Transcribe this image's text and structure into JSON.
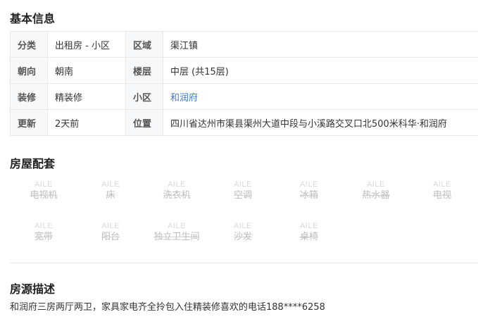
{
  "basic": {
    "title": "基本信息",
    "rows": [
      {
        "l1": "分类",
        "v1": "出租房 - 小区",
        "l2": "区域",
        "v2": "渠江镇"
      },
      {
        "l1": "朝向",
        "v1": "朝南",
        "l2": "楼层",
        "v2": "中层 (共15层)"
      },
      {
        "l1": "装修",
        "v1": "精装修",
        "l2": "小区",
        "v2": "和润府"
      },
      {
        "l1": "更新",
        "v1": "2天前",
        "l2": "位置",
        "v2": "四川省达州市渠县渠州大道中段与小溪路交叉口北500米科华·和润府"
      }
    ],
    "link_color": "#3a79d8"
  },
  "amenities": {
    "title": "房屋配套",
    "icon_text": "AILE",
    "items": [
      {
        "label": "电视机",
        "icon": "tv-icon"
      },
      {
        "label": "床",
        "icon": "bed-icon"
      },
      {
        "label": "洗衣机",
        "icon": "washing-machine-icon"
      },
      {
        "label": "空调",
        "icon": "air-conditioner-icon"
      },
      {
        "label": "冰箱",
        "icon": "fridge-icon"
      },
      {
        "label": "热水器",
        "icon": "water-heater-icon"
      },
      {
        "label": "电视",
        "icon": "television-icon"
      },
      {
        "label": "宽带",
        "icon": "broadband-icon"
      },
      {
        "label": "阳台",
        "icon": "balcony-icon"
      },
      {
        "label": "独立卫生间",
        "icon": "bathroom-icon"
      },
      {
        "label": "沙发",
        "icon": "sofa-icon"
      },
      {
        "label": "桌椅",
        "icon": "table-chair-icon"
      }
    ]
  },
  "description": {
    "title": "房源描述",
    "text": "和润府三房两厅两卫，家具家电齐全拎包入住精装修喜欢的电话188****6258"
  }
}
